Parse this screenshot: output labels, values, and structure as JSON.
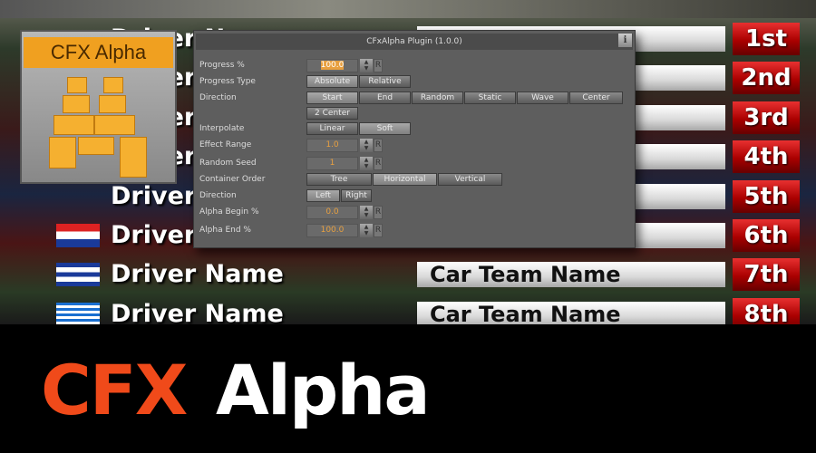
{
  "standings": [
    {
      "driver": "Driver Name",
      "team": "",
      "rank": "1st"
    },
    {
      "driver": "Driver Name",
      "team": "",
      "rank": "2nd"
    },
    {
      "driver": "Driver Name",
      "team": "",
      "rank": "3rd"
    },
    {
      "driver": "Driver Name",
      "team": "",
      "rank": "4th"
    },
    {
      "driver": "Driver Name",
      "team": "",
      "rank": "5th"
    },
    {
      "driver": "Driver Name",
      "team": "",
      "rank": "6th",
      "flag": "croatia"
    },
    {
      "driver": "Driver Name",
      "team": "Car Team Name",
      "rank": "7th",
      "flag": "cuba"
    },
    {
      "driver": "Driver Name",
      "team": "Car Team Name",
      "rank": "8th",
      "flag": "greece"
    }
  ],
  "thumbnail": {
    "label": "CFX Alpha"
  },
  "plugin": {
    "title": "CFxAlpha Plugin (1.0.0)",
    "info_icon": "i",
    "reset_label": "R",
    "progress": {
      "label": "Progress %",
      "value": "100.0"
    },
    "progress_type": {
      "label": "Progress Type",
      "options": [
        "Absolute",
        "Relative"
      ],
      "selected": "Absolute"
    },
    "direction": {
      "label": "Direction",
      "options": [
        "Start",
        "End",
        "Random",
        "Static",
        "Wave",
        "Center",
        "2 Center"
      ],
      "selected": "Start"
    },
    "interpolate": {
      "label": "Interpolate",
      "options": [
        "Linear",
        "Soft"
      ],
      "selected": "Soft"
    },
    "effect_range": {
      "label": "Effect Range",
      "value": "1.0"
    },
    "random_seed": {
      "label": "Random Seed",
      "value": "1"
    },
    "container_order": {
      "label": "Container Order",
      "options": [
        "Tree",
        "Horizontal",
        "Vertical"
      ],
      "selected": "Horizontal"
    },
    "direction2": {
      "label": "Direction",
      "options": [
        "Left",
        "Right"
      ],
      "selected": "Left"
    },
    "alpha_begin": {
      "label": "Alpha Begin %",
      "value": "0.0"
    },
    "alpha_end": {
      "label": "Alpha End %",
      "value": "100.0"
    }
  },
  "banner": {
    "word1": "CFX",
    "word2": "Alpha",
    "color": "#f04a1a"
  }
}
